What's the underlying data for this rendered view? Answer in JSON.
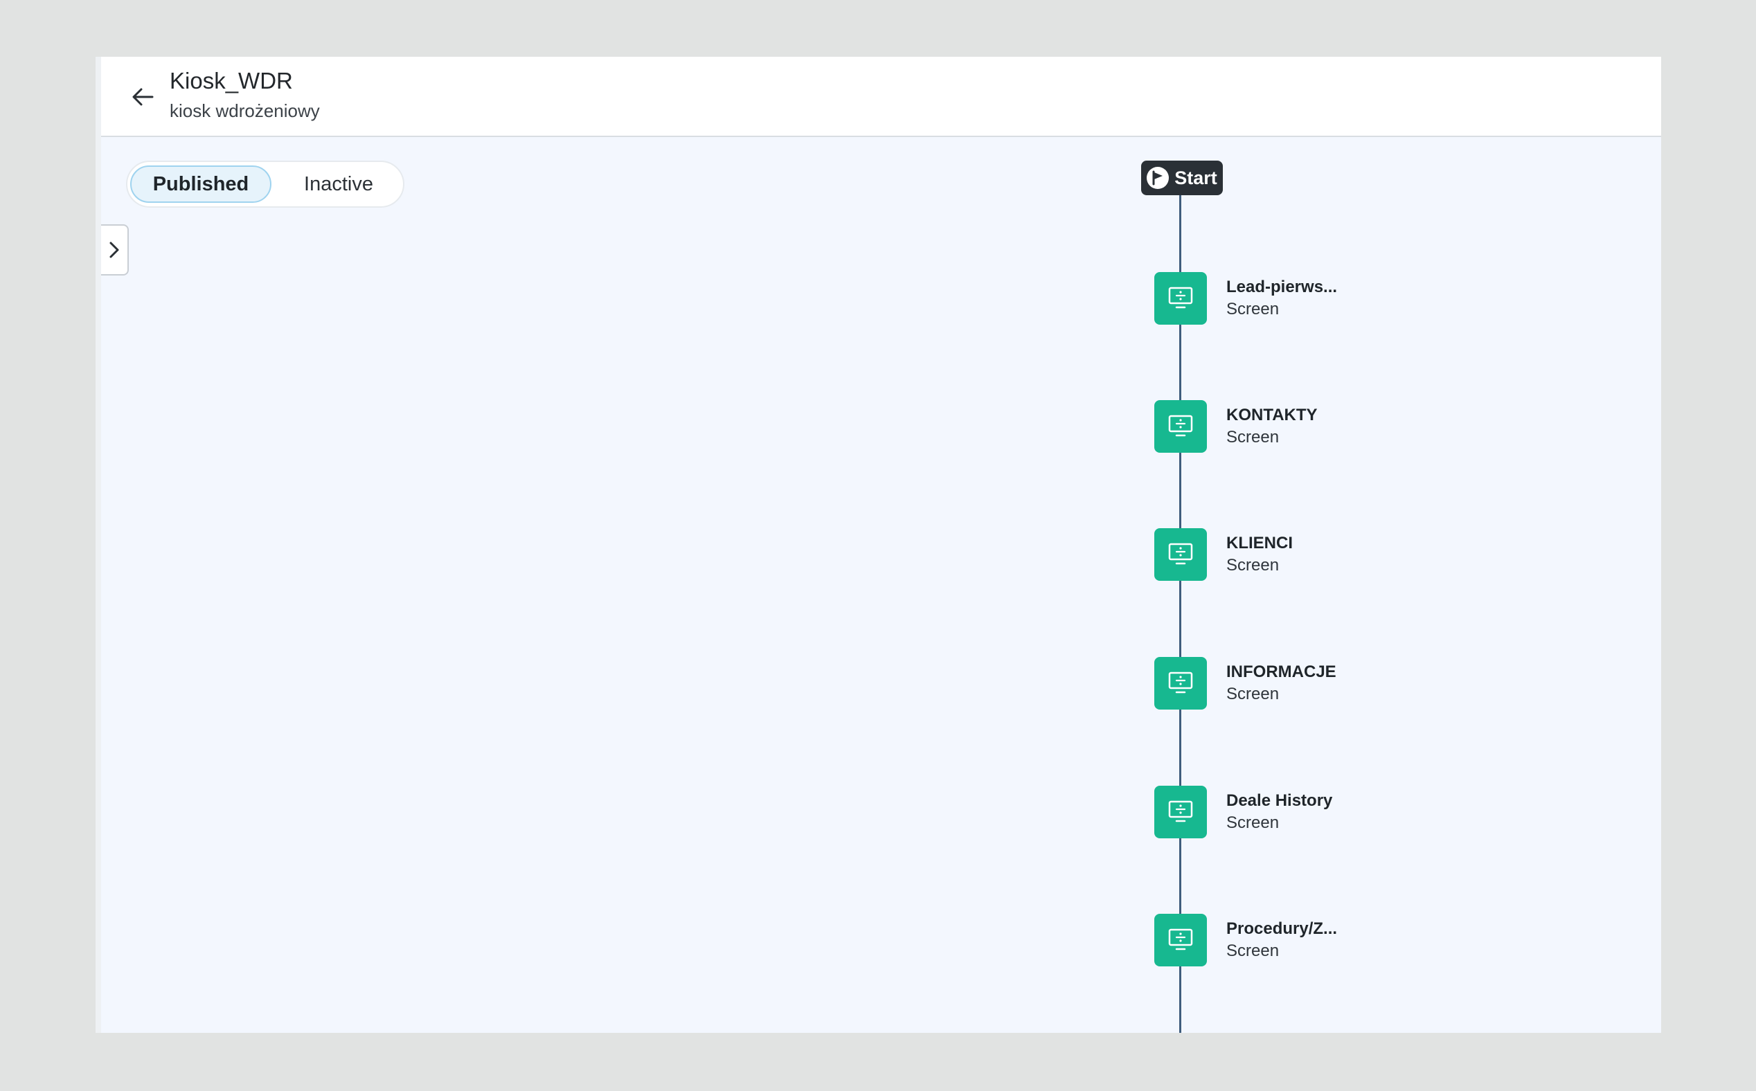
{
  "header": {
    "title": "Kiosk_WDR",
    "subtitle": "kiosk wdrożeniowy",
    "back_icon": "arrow-left-icon"
  },
  "status_toggle": {
    "options": [
      "Published",
      "Inactive"
    ],
    "selected": "Published"
  },
  "sidebar_toggle": {
    "icon": "chevron-right-icon"
  },
  "flow": {
    "start_label": "Start",
    "start_icon": "flag-icon",
    "node_icon": "screen-icon",
    "node_color": "#17b890",
    "line_color": "#3f5d7d",
    "nodes": [
      {
        "name": "Lead-pierws...",
        "type": "Screen"
      },
      {
        "name": "KONTAKTY",
        "type": "Screen"
      },
      {
        "name": "KLIENCI",
        "type": "Screen"
      },
      {
        "name": "INFORMACJE",
        "type": "Screen"
      },
      {
        "name": "Deale History",
        "type": "Screen"
      },
      {
        "name": "Procedury/Z...",
        "type": "Screen"
      }
    ]
  }
}
